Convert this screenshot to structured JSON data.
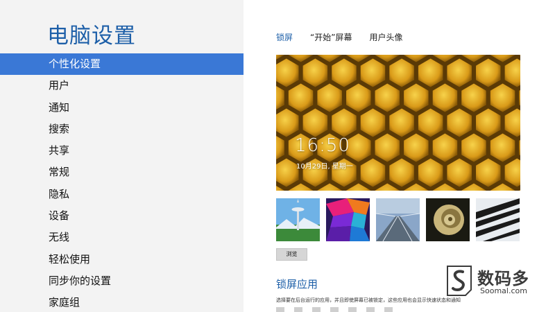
{
  "left": {
    "title": "电脑设置",
    "items": [
      {
        "label": "个性化设置",
        "active": true
      },
      {
        "label": "用户"
      },
      {
        "label": "通知"
      },
      {
        "label": "搜索"
      },
      {
        "label": "共享"
      },
      {
        "label": "常规"
      },
      {
        "label": "隐私"
      },
      {
        "label": "设备"
      },
      {
        "label": "无线"
      },
      {
        "label": "轻松使用"
      },
      {
        "label": "同步你的设置"
      },
      {
        "label": "家庭组"
      }
    ]
  },
  "right": {
    "tabs": [
      {
        "label": "锁屏",
        "active": true
      },
      {
        "label": "“开始”屏幕"
      },
      {
        "label": "用户头像"
      }
    ],
    "lockscreen": {
      "time": "16:50",
      "date": "10月29日, 星期一"
    },
    "thumbnails": [
      "seattle-space-needle",
      "colorful-geometric",
      "train-tracks",
      "nautilus-shell",
      "piano-keys"
    ],
    "browse_label": "浏览",
    "apps_section": {
      "title": "锁屏应用",
      "description": "选择要在后台运行的应用，并且即使屏幕已被锁定，这些应用也会显示快速状态和通知"
    }
  },
  "watermark": {
    "text": "数码多",
    "sub": "Soomal.com"
  },
  "colors": {
    "accent": "#1d5fa8",
    "selected_bg": "#3a78d6",
    "left_bg": "#f3f3f3"
  }
}
